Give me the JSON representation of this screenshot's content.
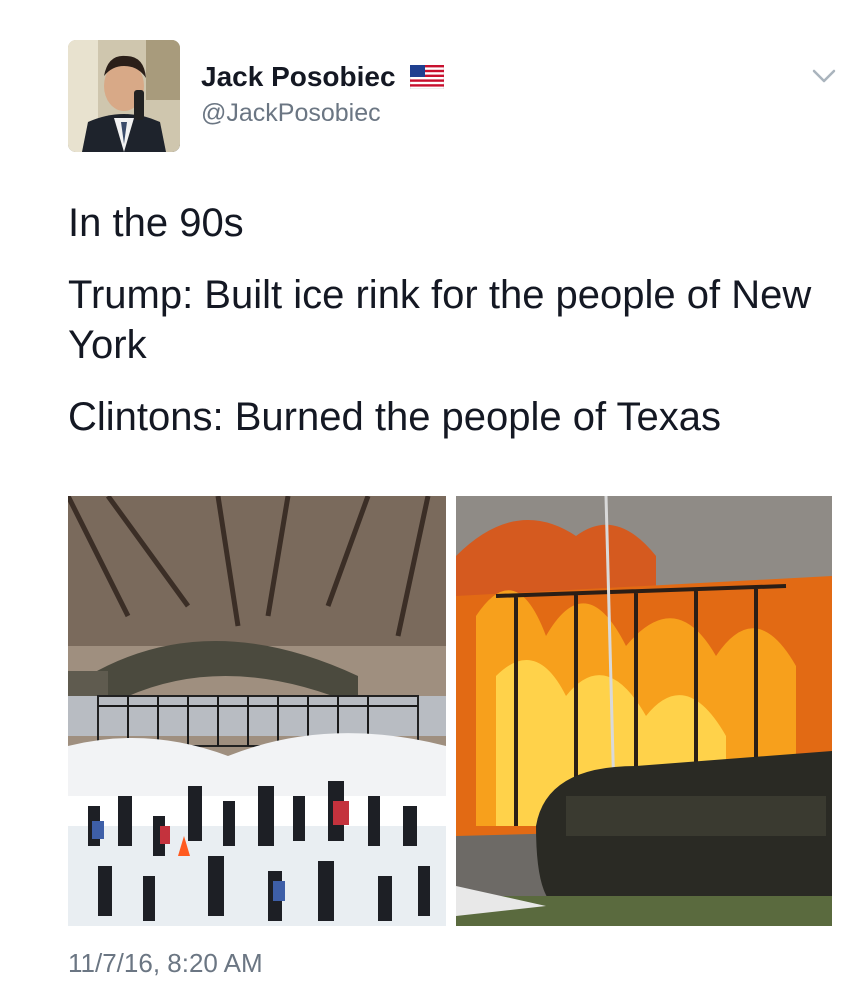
{
  "tweet": {
    "author": {
      "display_name": "Jack Posobiec",
      "handle": "@JackPosobiec",
      "flag_icon": "us-flag-icon"
    },
    "menu_icon": "chevron-down-icon",
    "lines": [
      "In the 90s",
      "Trump: Built ice rink for the people of New York",
      "Clintons: Burned the people of Texas"
    ],
    "timestamp": "11/7/16, 8:20 AM"
  },
  "colors": {
    "text": "#141823",
    "secondary": "#6b7683",
    "background": "#ffffff"
  }
}
